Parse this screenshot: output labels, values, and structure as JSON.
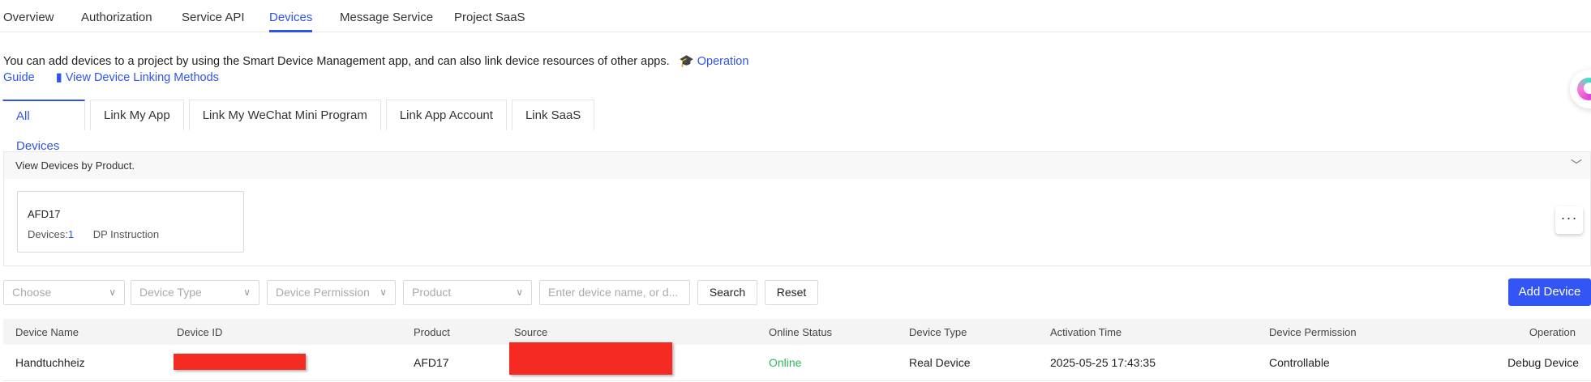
{
  "nav": {
    "items": [
      "Overview",
      "Authorization",
      "Service API",
      "Devices",
      "Message Service",
      "Project SaaS"
    ],
    "active": "Devices"
  },
  "intro": {
    "text": "You can add devices to a project by using the Smart Device Management app, and can also link device resources of other apps.",
    "operation_guide": "Operation Guide",
    "operation_guide_1": "Operation",
    "operation_guide_2": "Guide",
    "view_linking": "View Device Linking Methods"
  },
  "tabs": [
    "All Devices",
    "Link My App",
    "Link My WeChat Mini Program",
    "Link App Account",
    "Link SaaS"
  ],
  "products": {
    "header": "View Devices by Product.",
    "cards": [
      {
        "name": "AFD17",
        "devices_label": "Devices:",
        "devices_count": "1",
        "dp": "DP Instruction"
      }
    ]
  },
  "filters": {
    "choose": "Choose",
    "device_type": "Device Type",
    "device_permission": "Device Permission",
    "product": "Product",
    "search_placeholder": "Enter device name, or d...",
    "search": "Search",
    "reset": "Reset",
    "add_device": "Add Device"
  },
  "table": {
    "headers": [
      "Device Name",
      "Device ID",
      "Product",
      "Source",
      "Online Status",
      "Device Type",
      "Activation Time",
      "Device Permission",
      "Operation"
    ],
    "rows": [
      {
        "name": "Handtuchheiz",
        "product": "AFD17",
        "status": "Online",
        "type": "Real Device",
        "activation": "2025-05-25 17:43:35",
        "permission": "Controllable",
        "operation": "Debug Device"
      }
    ]
  },
  "colors": {
    "accent": "#2f54eb",
    "online": "#2db55d",
    "redaction": "#f42a23"
  }
}
